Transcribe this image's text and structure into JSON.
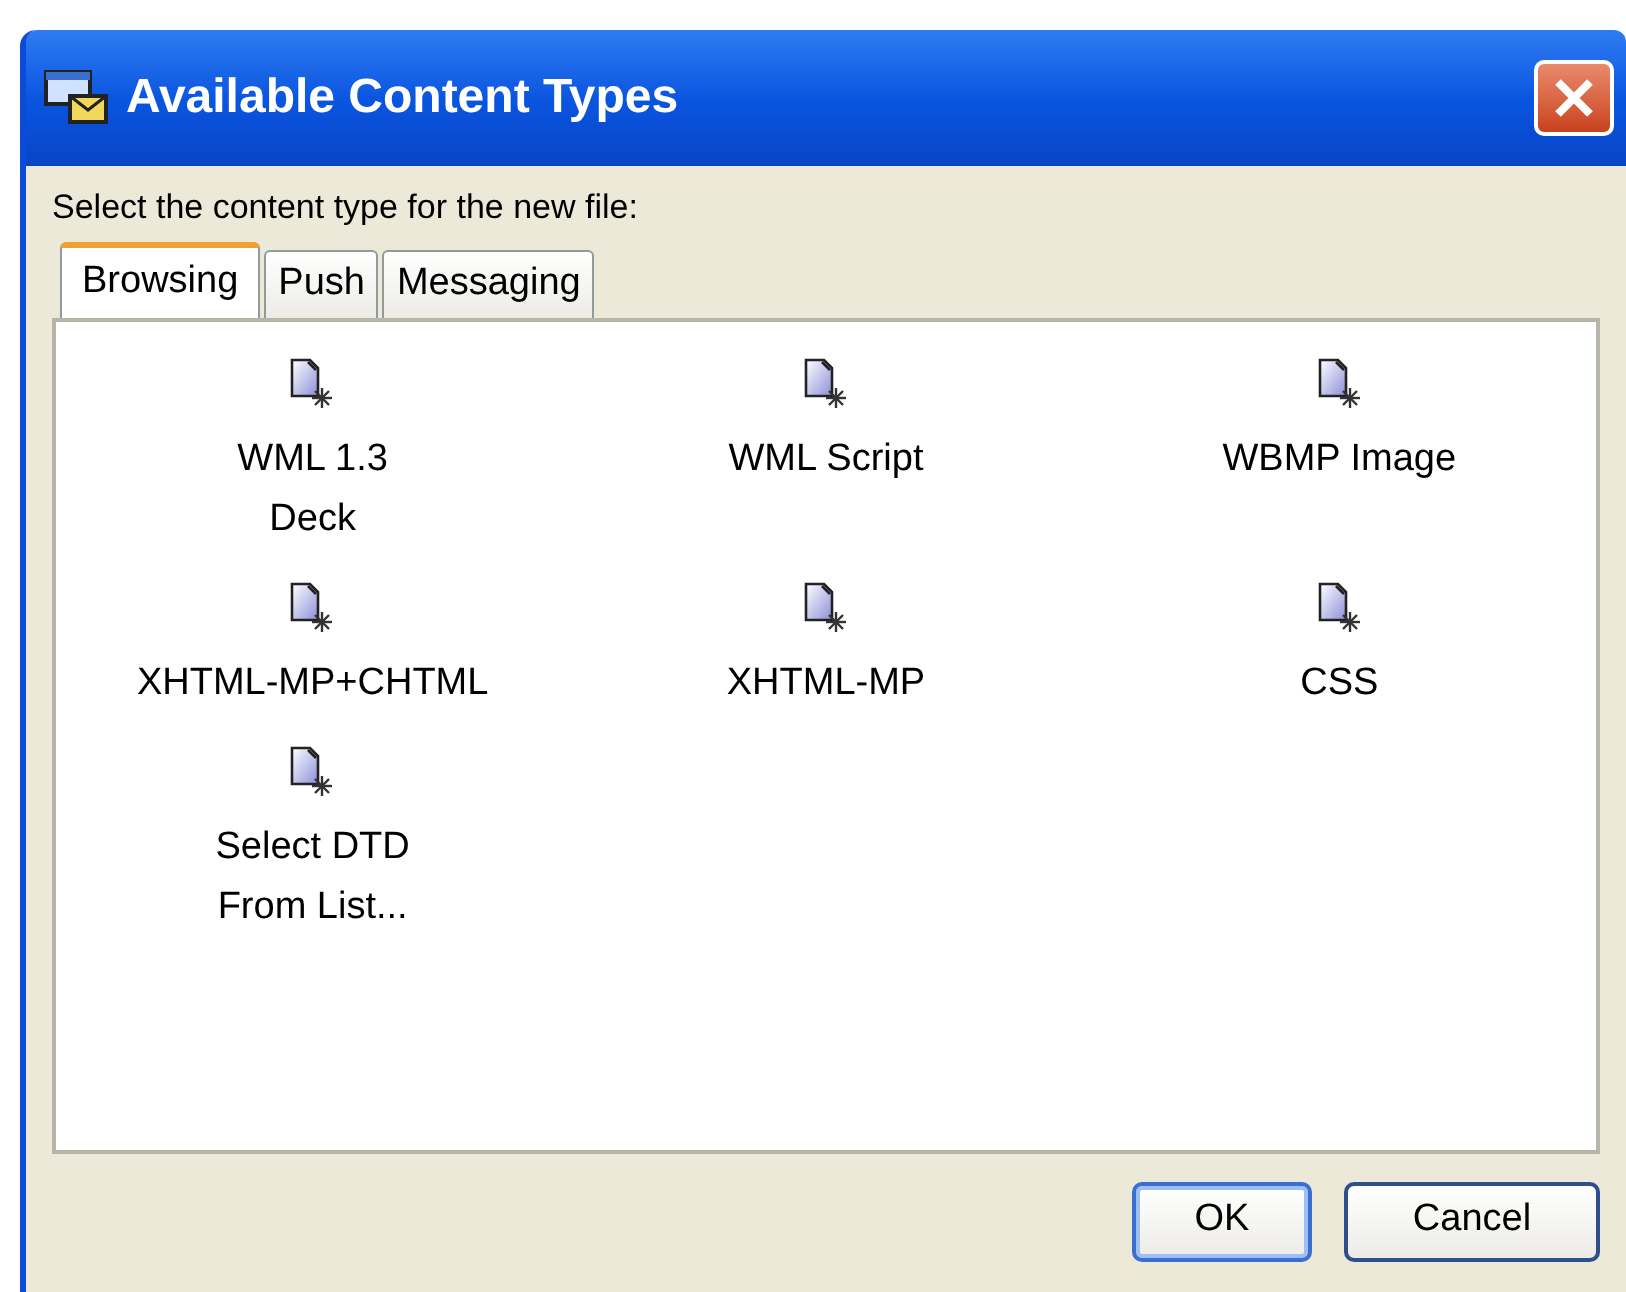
{
  "window": {
    "title": "Available Content Types"
  },
  "prompt": "Select the content type for the new file:",
  "tabs": [
    {
      "label": "Browsing",
      "selected": true
    },
    {
      "label": "Push",
      "selected": false
    },
    {
      "label": "Messaging",
      "selected": false
    }
  ],
  "items": [
    {
      "label": "WML 1.3\nDeck"
    },
    {
      "label": "WML Script"
    },
    {
      "label": "WBMP Image"
    },
    {
      "label": "XHTML-MP+CHTML"
    },
    {
      "label": "XHTML-MP"
    },
    {
      "label": "CSS"
    },
    {
      "label": "Select DTD\nFrom List..."
    }
  ],
  "buttons": [
    {
      "label": "OK",
      "selected": true
    },
    {
      "label": "Cancel",
      "selected": false
    }
  ]
}
